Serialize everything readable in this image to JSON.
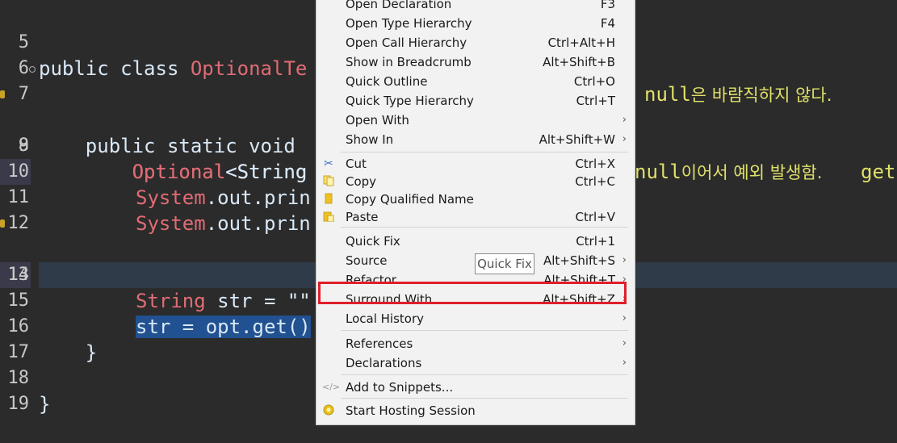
{
  "editor": {
    "lines": [
      {
        "num": "5"
      },
      {
        "num": "6"
      },
      {
        "num": "7"
      },
      {
        "num": "8"
      },
      {
        "num": "9"
      },
      {
        "num": "10"
      },
      {
        "num": "11"
      },
      {
        "num": "12"
      },
      {
        "num": "13"
      },
      {
        "num": "14"
      },
      {
        "num": "15"
      },
      {
        "num": "16"
      },
      {
        "num": "17"
      },
      {
        "num": "18"
      },
      {
        "num": "19"
      }
    ],
    "l5": {
      "a": "public class ",
      "b": "OptionalTe"
    },
    "l7": {
      "a": "    public static void "
    },
    "l8": {
      "a": "        ",
      "b": "Optional",
      "c": "<String",
      "comment_kw": "null",
      "comment_rest": "은 바람직하지 않다."
    },
    "l9": {
      "a": "        ",
      "b": "Optional",
      "c": "<String"
    },
    "l10": {
      "b": "System",
      "c": ".out.prin"
    },
    "l11": {
      "b": "System",
      "c": ".out.prin",
      "comment_kw": "null",
      "comment_rest": "이어서 예외 발생함.",
      "tail": "get"
    },
    "l13": {
      "b": "String",
      "c": " str = \"\""
    },
    "l15": {
      "sel": "str = opt.get()"
    },
    "l16": {
      "a": "    }"
    },
    "l18": {
      "a": "}"
    }
  },
  "context_menu": {
    "items": [
      {
        "label": "Open Declaration",
        "accel": "F3"
      },
      {
        "label": "Open Type Hierarchy",
        "accel": "F4"
      },
      {
        "label": "Open Call Hierarchy",
        "accel": "Ctrl+Alt+H"
      },
      {
        "label": "Show in Breadcrumb",
        "accel": "Alt+Shift+B"
      },
      {
        "label": "Quick Outline",
        "accel": "Ctrl+O"
      },
      {
        "label": "Quick Type Hierarchy",
        "accel": "Ctrl+T"
      },
      {
        "label": "Open With",
        "accel": ""
      },
      {
        "label": "Show In",
        "accel": "Alt+Shift+W"
      },
      {
        "label": "Cut",
        "accel": "Ctrl+X",
        "icon": "scissors-icon"
      },
      {
        "label": "Copy",
        "accel": "Ctrl+C",
        "icon": "copy-icon"
      },
      {
        "label": "Copy Qualified Name",
        "accel": "",
        "icon": "copy-qualified-icon"
      },
      {
        "label": "Paste",
        "accel": "Ctrl+V",
        "icon": "paste-icon"
      },
      {
        "label": "Quick Fix",
        "accel": "Ctrl+1"
      },
      {
        "label": "Source",
        "accel": "Alt+Shift+S"
      },
      {
        "label": "Refactor",
        "accel": "Alt+Shift+T"
      },
      {
        "label": "Surround With",
        "accel": "Alt+Shift+Z"
      },
      {
        "label": "Local History",
        "accel": ""
      },
      {
        "label": "References",
        "accel": ""
      },
      {
        "label": "Declarations",
        "accel": ""
      },
      {
        "label": "Add to Snippets...",
        "accel": "",
        "icon": "snippet-icon"
      },
      {
        "label": "Start Hosting Session",
        "accel": "",
        "icon": "hosting-icon"
      }
    ],
    "tooltip": "Quick Fix"
  },
  "colors": {
    "editor_bg": "#2b2b2b",
    "keyword_text": "#d9e8f7",
    "type_red": "#e06c75",
    "comment_yellow": "#e0e06a",
    "selection": "#215190",
    "menu_bg": "#f2f2f2",
    "highlight_border": "#e01e2b"
  }
}
